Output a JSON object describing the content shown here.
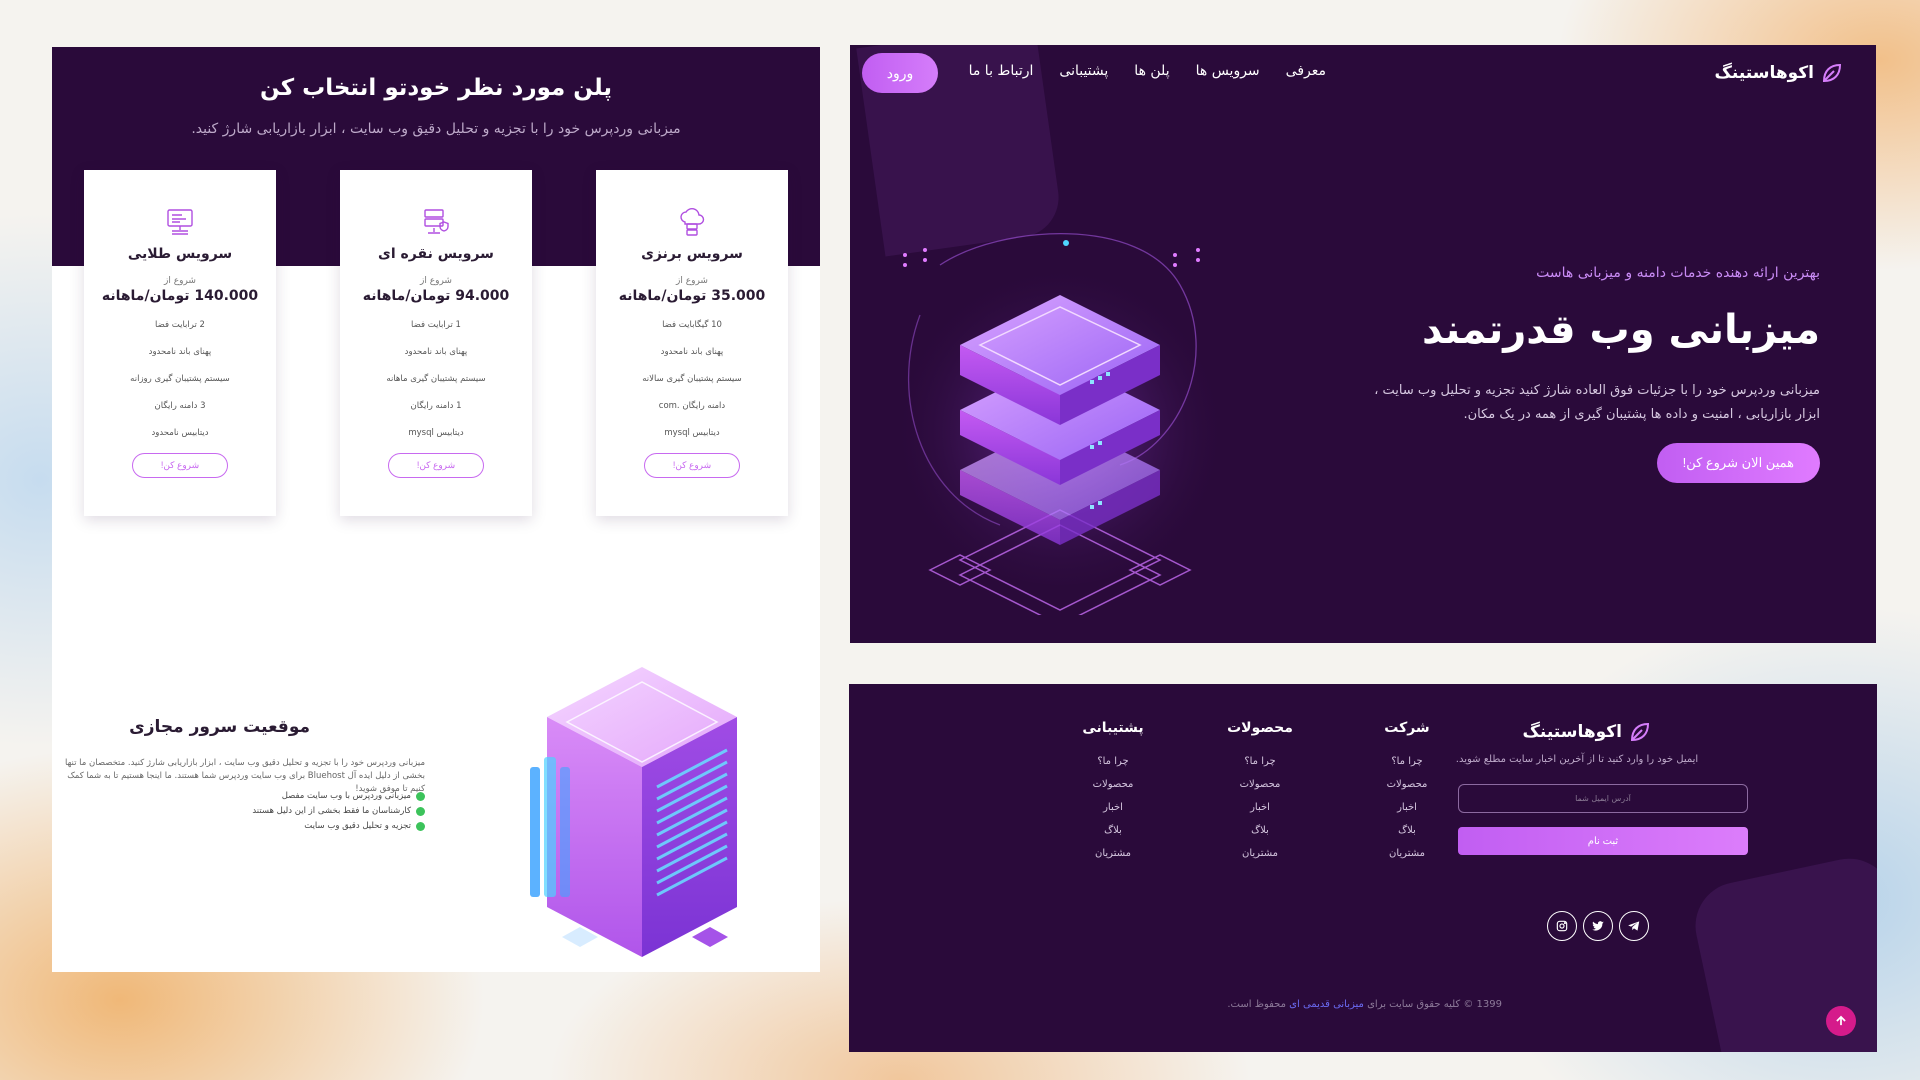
{
  "brand": {
    "name": "اکوهاستینگ",
    "accent": "#c15ef2",
    "dark": "#2a0a3a"
  },
  "hero": {
    "nav": [
      "معرفی",
      "سرویس ها",
      "پلن ها",
      "پشتیبانی",
      "ارتباط با ما"
    ],
    "login_label": "ورود",
    "subtitle": "بهترین ارائه دهنده خدمات دامنه و میزبانی هاست",
    "title": "میزبانی وب قدرتمند",
    "description": "میزبانی وردپرس خود را با جزئیات فوق العاده شارژ کنید تجزیه و تحلیل وب سایت ، ابزار بازاریابی ، امنیت و داده ها پشتیبان گیری از همه در یک مکان.",
    "cta_label": "همین الان شروع کن!"
  },
  "pricing": {
    "title": "پلن مورد نظر خودتو انتخاب کن",
    "subtitle": "میزبانی وردپرس خود را با تجزیه و تحلیل دقیق وب سایت ، ابزار بازاریابی شارژ کنید.",
    "plans": [
      {
        "title": "سرویس برنزی",
        "from": "شروع از",
        "price": "35.000 تومان/ماهانه",
        "features": [
          "10 گیگابایت فضا",
          "پهنای باند نامحدود",
          "سیستم پشتیبان گیری سالانه",
          "دامنه رایگان .com",
          "دیتابیس mysql"
        ],
        "button": "شروع کن!"
      },
      {
        "title": "سرویس نقره ای",
        "from": "شروع از",
        "price": "94.000 تومان/ماهانه",
        "features": [
          "1 ترابایت فضا",
          "پهنای باند نامحدود",
          "سیستم پشتیبان گیری ماهانه",
          "1 دامنه رایگان",
          "دیتابیس mysql"
        ],
        "button": "شروع کن!"
      },
      {
        "title": "سرویس طلایی",
        "from": "شروع از",
        "price": "140.000 تومان/ماهانه",
        "features": [
          "2 ترابایت فضا",
          "پهنای باند نامحدود",
          "سیستم پشتیبان گیری روزانه",
          "3 دامنه رایگان",
          "دیتابیس نامحدود"
        ],
        "button": "شروع کن!"
      }
    ]
  },
  "vps": {
    "title": "موقعیت سرور مجازی",
    "description": "میزبانی وردپرس خود را با تجزیه و تحلیل دقیق وب سایت ، ابزار بازاریابی شارژ کنید. متخصصان ما تنها بخشی از دلیل ایده آل Bluehost برای وب سایت وردپرس شما هستند. ما اینجا هستیم تا به شما کمک کنیم تا موفق شوید!",
    "items": [
      "میزبانی وردپرس با وب سایت مفصل",
      "کارشناسان ما فقط بخشی از این دلیل هستند",
      "تجزیه و تحلیل دقیق وب سایت"
    ]
  },
  "footer": {
    "news_text": "ایمیل خود را وارد کنید تا از آخرین اخبار سایت مطلع شوید.",
    "email_placeholder": "آدرس ایمیل شما",
    "signup_label": "ثبت نام",
    "columns": [
      {
        "title": "شرکت",
        "links": [
          "چرا ما؟",
          "محصولات",
          "اخبار",
          "بلاگ",
          "مشتریان"
        ]
      },
      {
        "title": "محصولات",
        "links": [
          "چرا ما؟",
          "محصولات",
          "اخبار",
          "بلاگ",
          "مشتریان"
        ]
      },
      {
        "title": "پشتیبانی",
        "links": [
          "چرا ما؟",
          "محصولات",
          "اخبار",
          "بلاگ",
          "مشتریان"
        ]
      }
    ],
    "social_icons": [
      "telegram-icon",
      "twitter-icon",
      "instagram-icon"
    ],
    "copyright_prefix": "1399 © کلیه حقوق سایت برای",
    "copyright_link": "میزبانی قدیمی ای",
    "copyright_suffix": "محفوظ است."
  }
}
